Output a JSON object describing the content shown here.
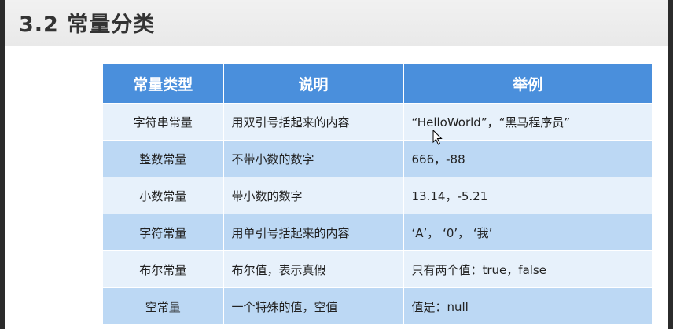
{
  "title": "3.2 常量分类",
  "table": {
    "headers": [
      "常量类型",
      "说明",
      "举例"
    ],
    "rows": [
      {
        "type": "字符串常量",
        "description": "用双引号括起来的内容",
        "example": "“HelloWorld”，“黑马程序员”"
      },
      {
        "type": "整数常量",
        "description": "不带小数的数字",
        "example": "666，-88"
      },
      {
        "type": "小数常量",
        "description": "带小数的数字",
        "example": "13.14，-5.21"
      },
      {
        "type": "字符常量",
        "description": "用单引号括起来的内容",
        "example": "‘A’， ‘0’， ‘我’"
      },
      {
        "type": "布尔常量",
        "description": "布尔值，表示真假",
        "example": "只有两个值：true，false"
      },
      {
        "type": "空常量",
        "description": "一个特殊的值，空值",
        "example": "值是：null"
      }
    ]
  },
  "colors": {
    "header": "#4a8fdc",
    "row_light": "#e7f1fb",
    "row_dark": "#bcd8f4"
  },
  "cursor": {
    "icon": "mouse-pointer-icon"
  }
}
